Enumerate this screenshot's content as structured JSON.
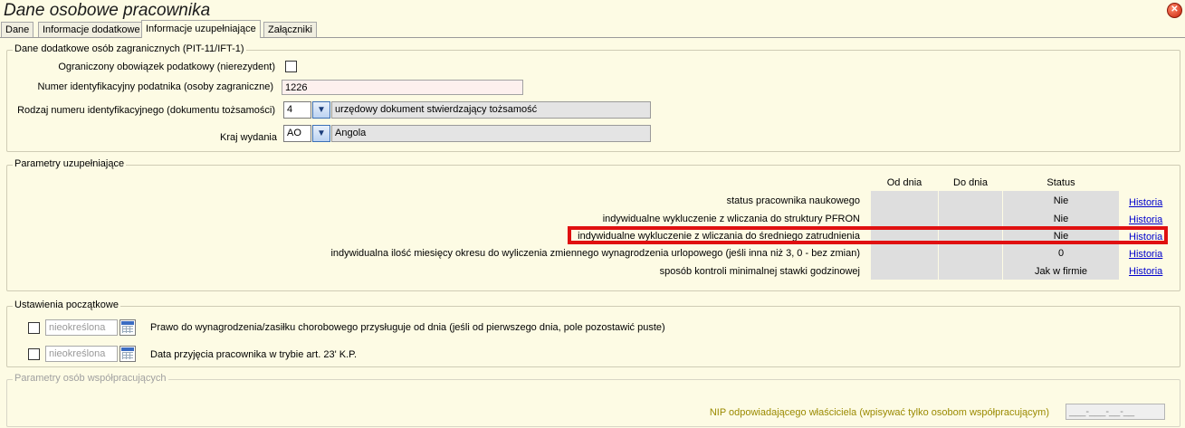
{
  "window": {
    "title": "Dane osobowe pracownika"
  },
  "tabs": [
    "Dane",
    "Informacje dodatkowe",
    "Informacje uzupełniające",
    "Załączniki"
  ],
  "foreign": {
    "title": "Dane dodatkowe osób zagranicznych (PIT-11/IFT-1)",
    "limited_tax_label": "Ograniczony obowiązek podatkowy (nierezydent)",
    "limited_tax_checked": false,
    "tax_id_label": "Numer identyfikacyjny podatnika (osoby zagraniczne)",
    "tax_id_value": "1226",
    "id_type_label": "Rodzaj numeru identyfikacyjnego (dokumentu tożsamości)",
    "id_type_code": "4",
    "id_type_desc": "urzędowy dokument stwierdzający tożsamość",
    "country_label": "Kraj wydania",
    "country_code": "AO",
    "country_name": "Angola"
  },
  "params": {
    "title": "Parametry uzupełniające",
    "col_from": "Od dnia",
    "col_to": "Do dnia",
    "col_status": "Status",
    "rows": [
      {
        "label": "status pracownika naukowego",
        "status": "Nie",
        "history": "Historia"
      },
      {
        "label": "indywidualne wykluczenie z wliczania do struktury PFRON",
        "status": "Nie",
        "history": "Historia"
      },
      {
        "label": "indywidualne wykluczenie z wliczania do średniego zatrudnienia",
        "status": "Nie",
        "history": "Historia"
      },
      {
        "label": "indywidualna ilość miesięcy okresu do wyliczenia zmiennego wynagrodzenia urlopowego (jeśli inna niż 3, 0 - bez zmian)",
        "status": "0",
        "history": "Historia"
      },
      {
        "label": "sposób kontroli minimalnej stawki godzinowej",
        "status": "Jak w firmie",
        "history": "Historia"
      }
    ]
  },
  "initial": {
    "title": "Ustawienia początkowe",
    "rows": [
      {
        "date": "nieokreślona",
        "label": "Prawo do  wynagrodzenia/zasiłku chorobowego przysługuje od dnia (jeśli od pierwszego dnia, pole pozostawić puste)"
      },
      {
        "date": "nieokreślona",
        "label": "Data przyjęcia pracownika w trybie art. 23' K.P."
      }
    ]
  },
  "cooperating": {
    "title": "Parametry osób współpracujących",
    "nip_label": "NIP odpowiadającego właściciela (wpisywać tylko osobom współpracującym)",
    "nip_mask": "___-___-__-__"
  },
  "colors": {
    "highlight": "#e01010",
    "link": "#0000cc",
    "background": "#fdfbe4",
    "nip_label": "#9a8a00"
  }
}
